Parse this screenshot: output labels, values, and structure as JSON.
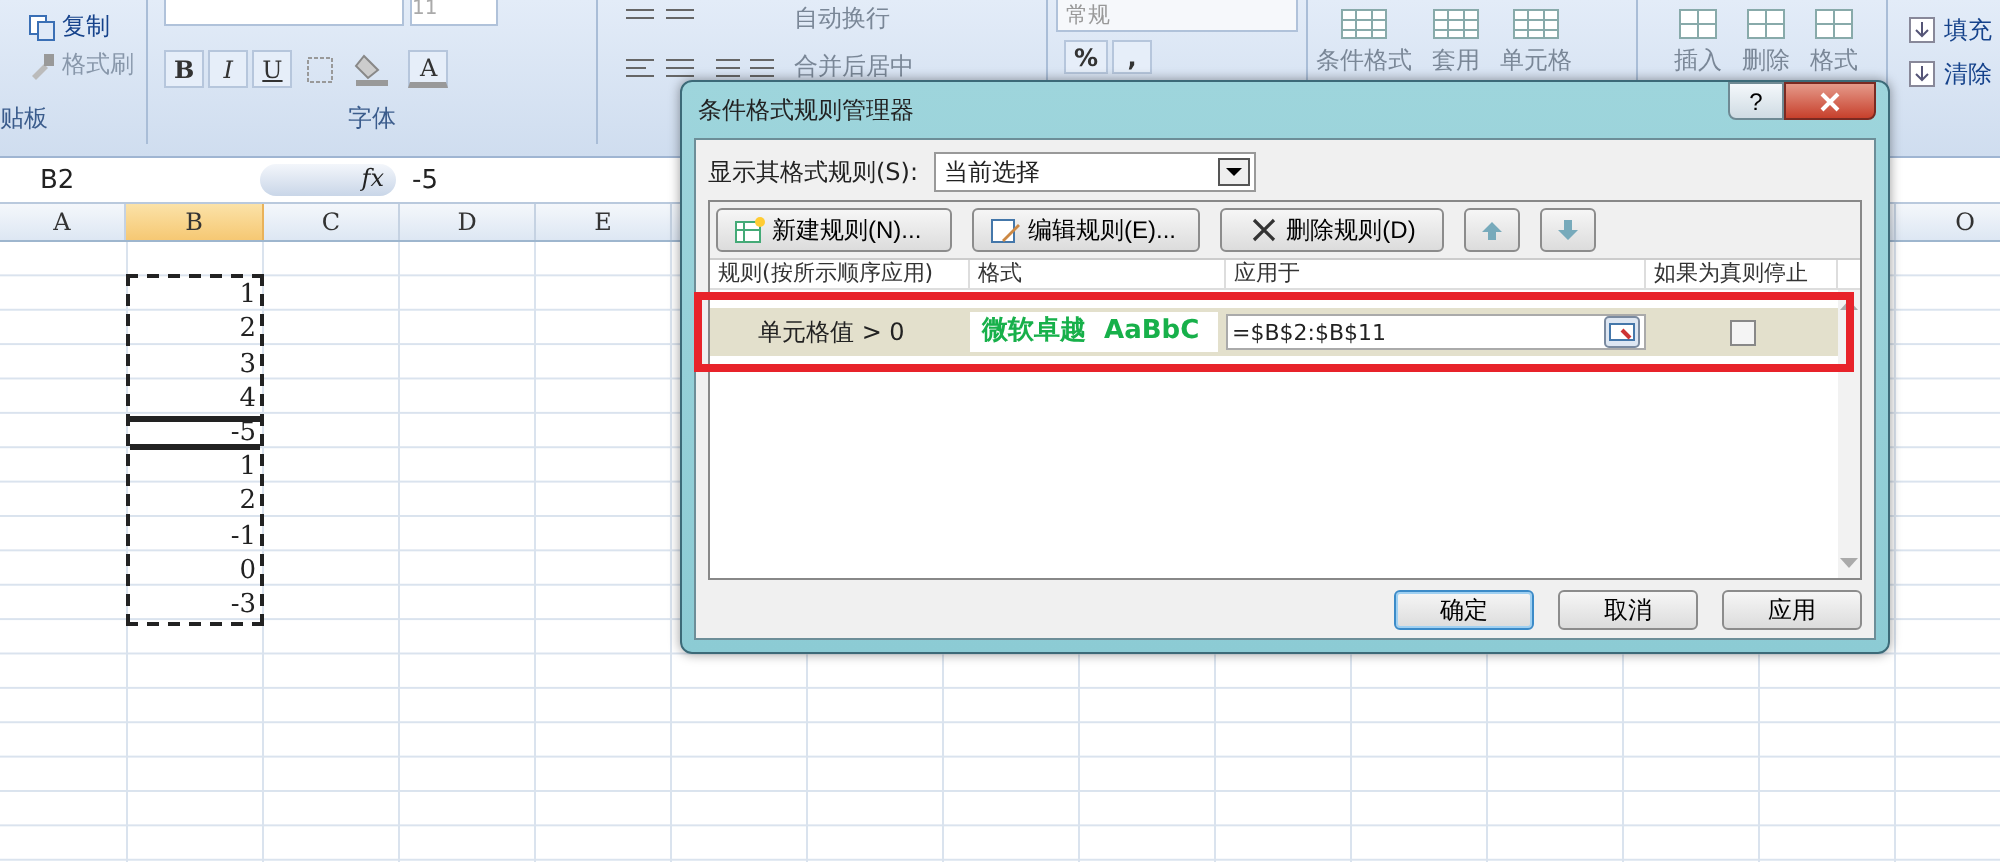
{
  "ribbon": {
    "clipboard": {
      "items": [
        {
          "label": "复制",
          "kind": "copy"
        },
        {
          "label": "格式刷",
          "kind": "brush"
        }
      ],
      "group_label": "贴板"
    },
    "font": {
      "size": "11",
      "styles": [
        "B",
        "I",
        "U"
      ],
      "color_letter": "A",
      "group_label": "字体"
    },
    "alignment": {
      "wrap": "自动换行",
      "merge": "合并后居中"
    },
    "number": {
      "format": "常规",
      "buttons": [
        "%",
        ","
      ]
    },
    "styles": [
      "条件格式",
      "套用",
      "单元格"
    ],
    "cells": [
      "插入",
      "删除",
      "格式"
    ],
    "editing": [
      "填充",
      "清除"
    ]
  },
  "formula_bar": {
    "name_box": "B2",
    "fx": "fx",
    "value": "-5"
  },
  "sheet": {
    "columns_left": [
      {
        "label": "A",
        "selected": false
      },
      {
        "label": "B",
        "selected": true
      },
      {
        "label": "C",
        "selected": false
      },
      {
        "label": "D",
        "selected": false
      },
      {
        "label": "E",
        "selected": false
      }
    ],
    "columns_right": [
      {
        "label": "O",
        "selected": false
      }
    ],
    "values": [
      {
        "value": "1",
        "selected": false
      },
      {
        "value": "2",
        "selected": false
      },
      {
        "value": "3",
        "selected": false
      },
      {
        "value": "4",
        "selected": false
      },
      {
        "value": "-5",
        "selected": true
      },
      {
        "value": "1",
        "selected": false
      },
      {
        "value": "2",
        "selected": false
      },
      {
        "value": "-1",
        "selected": false
      },
      {
        "value": "0",
        "selected": false
      },
      {
        "value": "-3",
        "selected": false
      }
    ]
  },
  "dialog": {
    "title": "条件格式规则管理器",
    "help": "?",
    "show_rules_label": "显示其格式规则(S):",
    "show_rules_value": "当前选择",
    "buttons": [
      {
        "label": "新建规则(N)...",
        "kind": "new"
      },
      {
        "label": "编辑规则(E)...",
        "kind": "edit"
      },
      {
        "label": "删除规则(D)",
        "kind": "delete"
      }
    ],
    "columns": [
      "规则(按所示顺序应用)",
      "格式",
      "应用于",
      "如果为真则停止"
    ],
    "rules": [
      {
        "rule": "单元格值 > 0",
        "preview": "微软卓越  AaBbC",
        "applies_to": "=$B$2:$B$11",
        "stop_if_true": false,
        "selected": true
      }
    ],
    "footer_buttons": [
      {
        "label": "确定",
        "default": true
      },
      {
        "label": "取消",
        "default": false
      },
      {
        "label": "应用",
        "default": false
      }
    ]
  }
}
